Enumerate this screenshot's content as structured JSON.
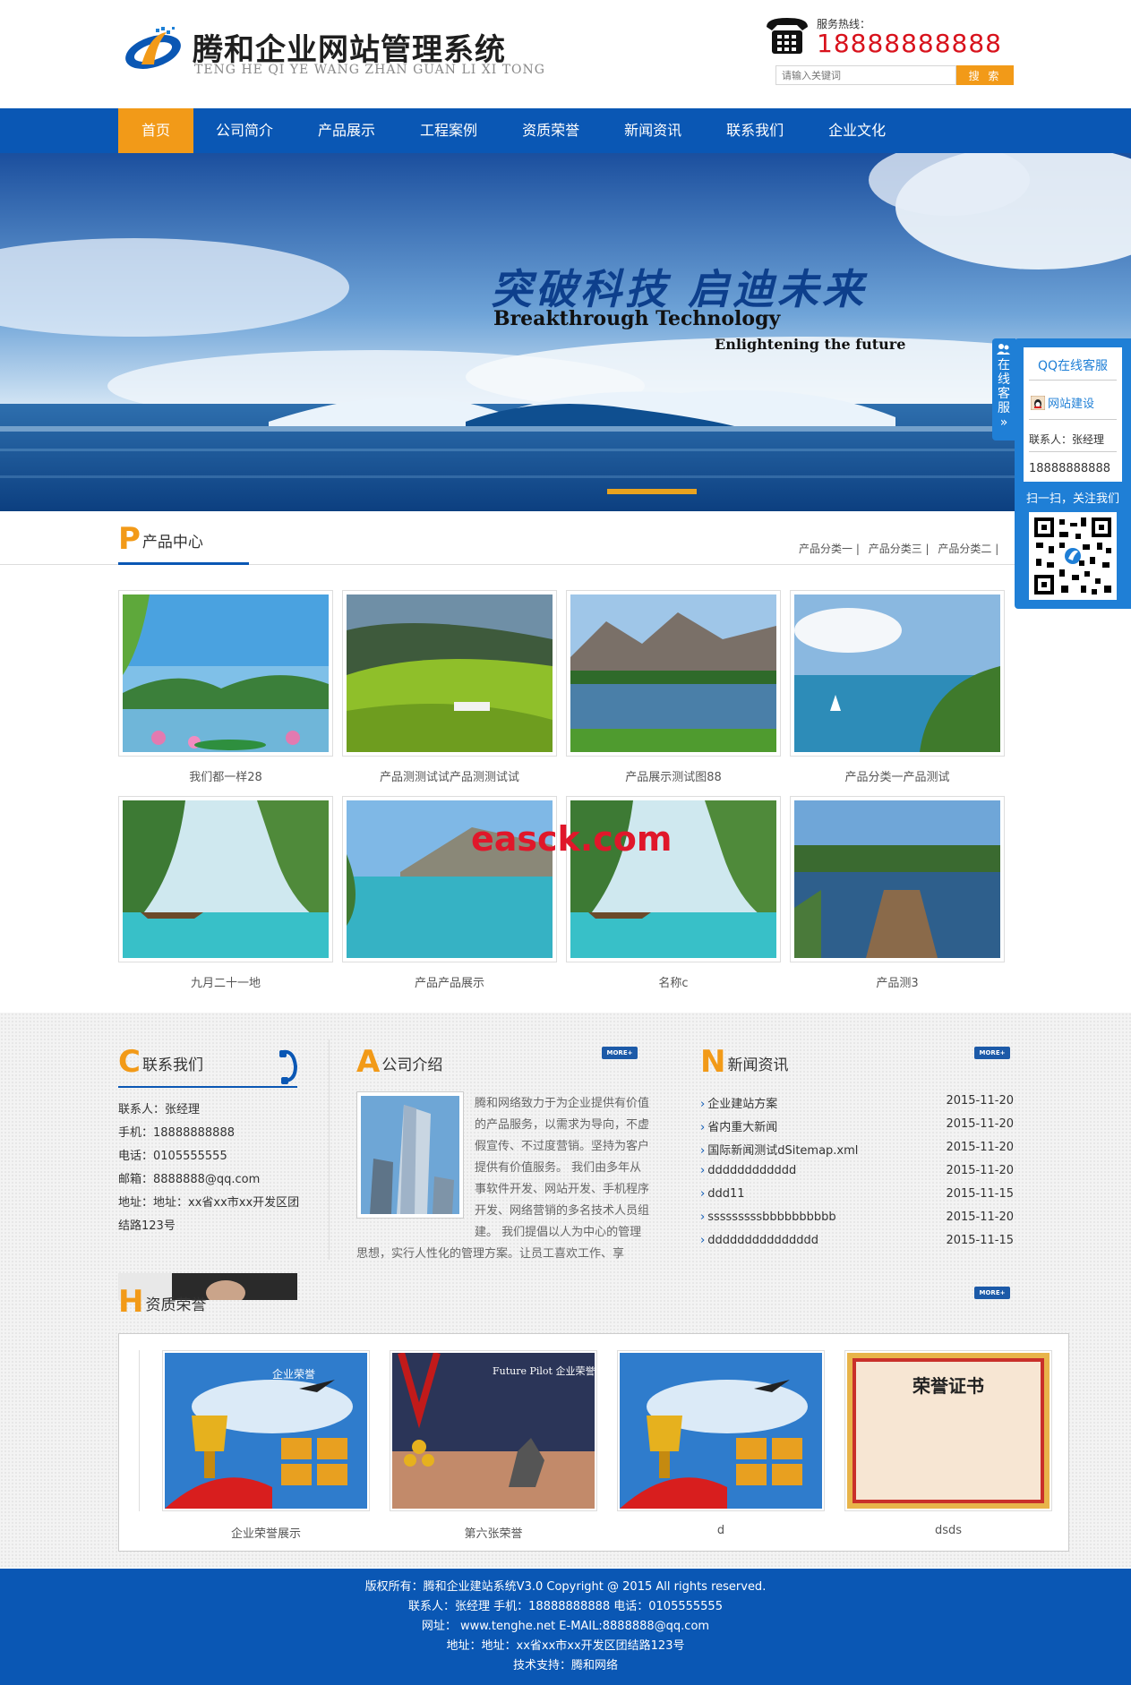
{
  "header": {
    "logo_title": "腾和企业网站管理系统",
    "logo_sub": "TENG HE QI YE WANG ZHAN GUAN LI XI TONG",
    "hotline_label": "服务热线：",
    "hotline_number": "18888888888",
    "search_placeholder": "请输入关键词",
    "search_button": "搜 索"
  },
  "nav": {
    "items": [
      {
        "label": "首页",
        "active": true
      },
      {
        "label": "公司简介"
      },
      {
        "label": "产品展示"
      },
      {
        "label": "工程案例"
      },
      {
        "label": "资质荣誉"
      },
      {
        "label": "新闻资讯"
      },
      {
        "label": "联系我们"
      },
      {
        "label": "企业文化"
      }
    ]
  },
  "banner": {
    "headline_cn": "突破科技 启迪未来",
    "headline_en": "Breakthrough Technology",
    "subline_en": "Enlightening the future"
  },
  "products": {
    "letter": "P",
    "title": "产品中心",
    "categories": [
      "产品分类一 |",
      "产品分类三 |",
      "产品分类二 |"
    ],
    "items": [
      {
        "name": "我们都一样28"
      },
      {
        "name": "产品测测试试产品测测试试"
      },
      {
        "name": "产品展示测试图88"
      },
      {
        "name": "产品分类一产品测试"
      },
      {
        "name": "九月二十一地"
      },
      {
        "name": "产品产品展示"
      },
      {
        "name": "名称c"
      },
      {
        "name": "产品测3"
      }
    ]
  },
  "watermark": "easck.com",
  "contact": {
    "letter": "C",
    "title": "联系我们",
    "person": "联系人：张经理",
    "mobile": "手机：18888888888",
    "phone": "电话：0105555555",
    "email": "邮箱：8888888@qq.com",
    "address": "地址：地址：xx省xx市xx开发区团结路123号"
  },
  "about": {
    "letter": "A",
    "title": "公司介绍",
    "more": "MORE+",
    "text": "腾和网络致力于为企业提供有价值的产品服务，以需求为导向，不虚假宣传、不过度营销。坚持为客户提供有价值服务。 我们由多年从事软件开发、网站开发、手机程序开发、网络营销的多名技术人员组建。 我们提倡以人为中心的管理思想，实行人性化的管理方案。让员工喜欢工作、享"
  },
  "news": {
    "letter": "N",
    "title": "新闻资讯",
    "more": "MORE+",
    "items": [
      {
        "title": "企业建站方案",
        "date": "2015-11-20"
      },
      {
        "title": "省内重大新闻",
        "date": "2015-11-20"
      },
      {
        "title": "国际新闻测试dSitemap.xml",
        "date": "2015-11-20"
      },
      {
        "title": "dddddddddddd",
        "date": "2015-11-20"
      },
      {
        "title": "ddd11",
        "date": "2015-11-15"
      },
      {
        "title": "sssssssssbbbbbbbbbb",
        "date": "2015-11-20"
      },
      {
        "title": "ddddddddddddddd",
        "date": "2015-11-15"
      }
    ]
  },
  "honors": {
    "letter": "H",
    "title": "资质荣誉",
    "more": "MORE+",
    "items": [
      {
        "name": "企业荣誉展示"
      },
      {
        "name": "第六张荣誉"
      },
      {
        "name": "d"
      },
      {
        "name": "dsds"
      }
    ],
    "pilot_caption": "Future Pilot 企业荣誉",
    "cert_caption": "荣誉证书",
    "honor_caption": "企业荣誉"
  },
  "footer": {
    "line1": "版权所有：腾和企业建站系统V3.0 Copyright @ 2015 All rights reserved.",
    "line2": "联系人：张经理 手机：18888888888 电话：0105555555",
    "line3": "网址： www.tenghe.net E-MAIL:8888888@qq.com",
    "line4": "地址：地址：xx省xx市xx开发区团结路123号",
    "line5": "技术支持：腾和网络"
  },
  "qq_panel": {
    "tab_chars": [
      "在",
      "线",
      "客",
      "服",
      "»"
    ],
    "title": "QQ在线客服",
    "site": "网站建设",
    "contact": "联系人：张经理",
    "phone": "18888888888",
    "scan": "扫一扫，关注我们"
  },
  "colors": {
    "brand_blue": "#0a57b4",
    "accent_orange": "#f29a18",
    "hotline_red": "#d8121c"
  }
}
